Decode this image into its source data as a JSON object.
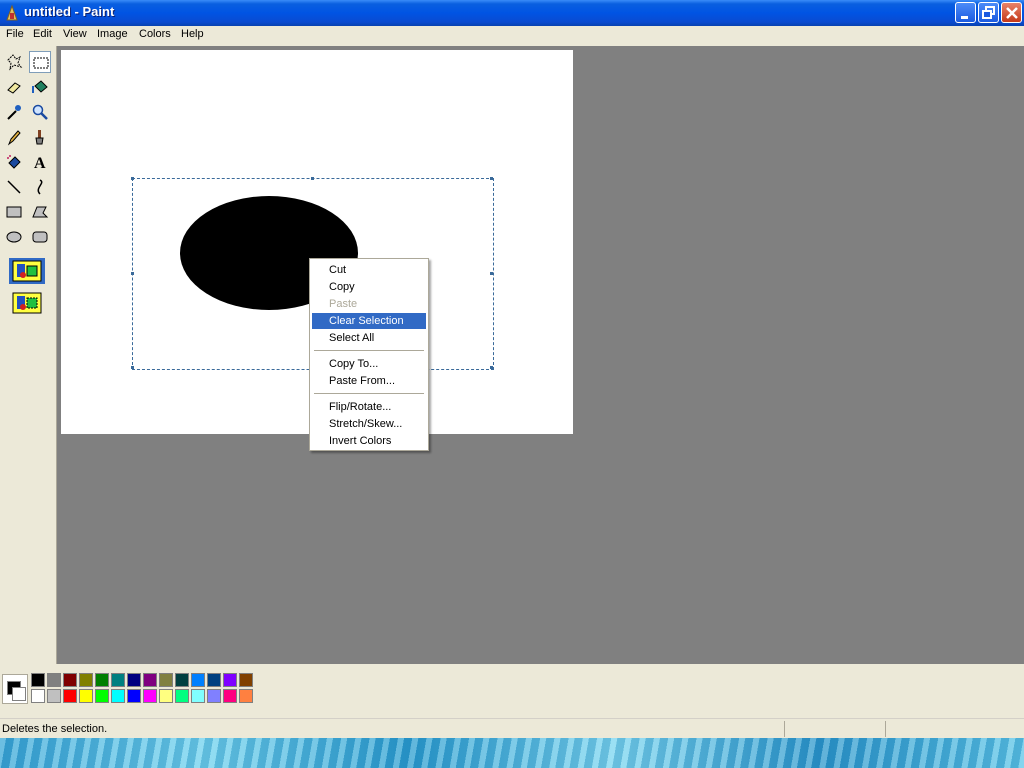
{
  "window": {
    "title": "untitled - Paint"
  },
  "menu": [
    "File",
    "Edit",
    "View",
    "Image",
    "Colors",
    "Help"
  ],
  "tools": [
    "free-form-select-icon",
    "select-icon",
    "eraser-icon",
    "fill-icon",
    "pick-color-icon",
    "magnifier-icon",
    "pencil-icon",
    "brush-icon",
    "airbrush-icon",
    "text-icon",
    "line-icon",
    "curve-icon",
    "rectangle-icon",
    "polygon-icon",
    "ellipse-icon",
    "rounded-rectangle-icon"
  ],
  "selected_tool": "select-icon",
  "text_tool_glyph": "A",
  "context_menu": {
    "items": [
      "Cut",
      "Copy",
      "Paste",
      "Clear Selection",
      "Select All",
      "Copy To...",
      "Paste From...",
      "Flip/Rotate...",
      "Stretch/Skew...",
      "Invert Colors"
    ],
    "disabled": "Paste",
    "highlighted": "Clear Selection"
  },
  "palette": {
    "foreground": "#000000",
    "background": "#ffffff",
    "row1": [
      "#000000",
      "#808080",
      "#800000",
      "#808000",
      "#008000",
      "#008080",
      "#000080",
      "#800080",
      "#808040",
      "#004040",
      "#0080ff",
      "#004080",
      "#8000ff",
      "#804000"
    ],
    "row2": [
      "#ffffff",
      "#c0c0c0",
      "#ff0000",
      "#ffff00",
      "#00ff00",
      "#00ffff",
      "#0000ff",
      "#ff00ff",
      "#ffff80",
      "#00ff80",
      "#80ffff",
      "#8080ff",
      "#ff0080",
      "#ff8040"
    ]
  },
  "status": {
    "text": "Deletes the selection."
  }
}
